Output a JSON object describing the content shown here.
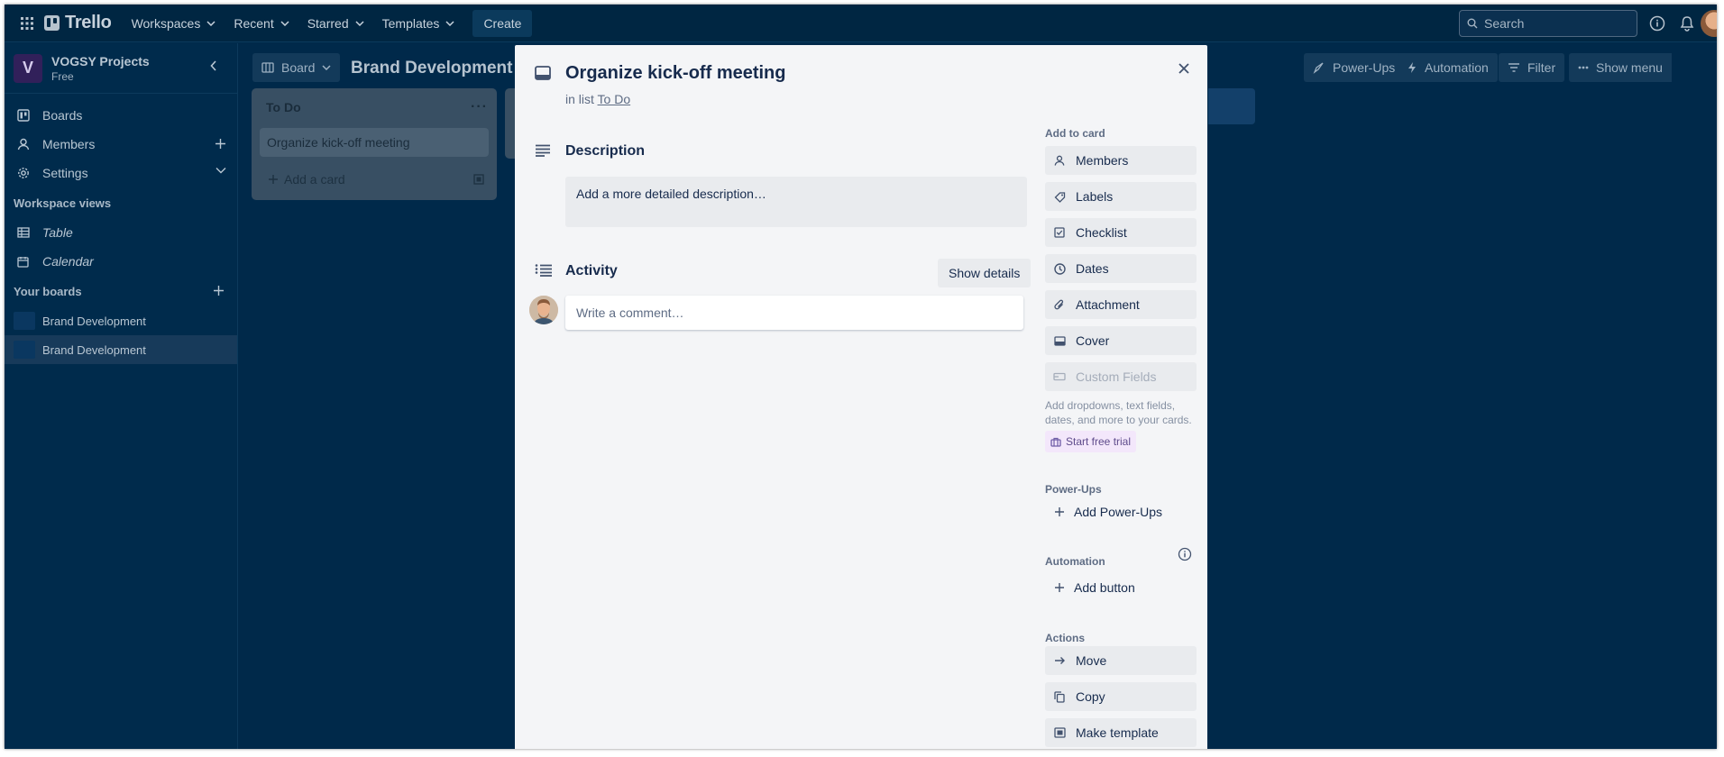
{
  "topbar": {
    "app_name": "Trello",
    "nav": [
      "Workspaces",
      "Recent",
      "Starred",
      "Templates"
    ],
    "create_label": "Create",
    "search_placeholder": "Search"
  },
  "sidebar": {
    "workspace_initial": "V",
    "workspace_name": "VOGSY Projects",
    "workspace_plan": "Free",
    "items": [
      {
        "label": "Boards",
        "icon": "board-icon"
      },
      {
        "label": "Members",
        "icon": "person-icon"
      },
      {
        "label": "Settings",
        "icon": "gear-icon"
      }
    ],
    "views_heading": "Workspace views",
    "views": [
      {
        "label": "Table",
        "icon": "table-icon"
      },
      {
        "label": "Calendar",
        "icon": "calendar-icon"
      }
    ],
    "boards_heading": "Your boards",
    "boards": [
      {
        "label": "Brand Development",
        "active": false
      },
      {
        "label": "Brand Development",
        "active": true
      }
    ]
  },
  "board": {
    "view_label": "Board",
    "title": "Brand Development",
    "powerups_label": "Power-Ups",
    "automation_label": "Automation",
    "filter_label": "Filter",
    "show_menu_label": "Show menu",
    "lists": [
      {
        "title": "To Do",
        "cards": [
          "Organize kick-off meeting"
        ],
        "add_card_label": "Add a card"
      }
    ]
  },
  "card_modal": {
    "title": "Organize kick-off meeting",
    "in_list_prefix": "in list",
    "list_name": "To Do",
    "description_heading": "Description",
    "description_placeholder": "Add a more detailed description…",
    "activity_heading": "Activity",
    "show_details_label": "Show details",
    "comment_placeholder": "Write a comment…",
    "add_to_card_heading": "Add to card",
    "add_to_card": [
      {
        "label": "Members",
        "icon": "person-icon",
        "disabled": false
      },
      {
        "label": "Labels",
        "icon": "tag-icon",
        "disabled": false
      },
      {
        "label": "Checklist",
        "icon": "checkbox-icon",
        "disabled": false
      },
      {
        "label": "Dates",
        "icon": "clock-icon",
        "disabled": false
      },
      {
        "label": "Attachment",
        "icon": "paperclip-icon",
        "disabled": false
      },
      {
        "label": "Cover",
        "icon": "cover-icon",
        "disabled": false
      },
      {
        "label": "Custom Fields",
        "icon": "custom-fields-icon",
        "disabled": true
      }
    ],
    "custom_fields_hint": "Add dropdowns, text fields, dates, and more to your cards.",
    "start_trial_label": "Start free trial",
    "powerups_heading": "Power-Ups",
    "add_powerups_label": "Add Power-Ups",
    "automation_heading": "Automation",
    "add_button_label": "Add button",
    "actions_heading": "Actions",
    "actions": [
      {
        "label": "Move",
        "icon": "arrow-right-icon"
      },
      {
        "label": "Copy",
        "icon": "copy-icon"
      },
      {
        "label": "Make template",
        "icon": "template-icon"
      }
    ]
  }
}
